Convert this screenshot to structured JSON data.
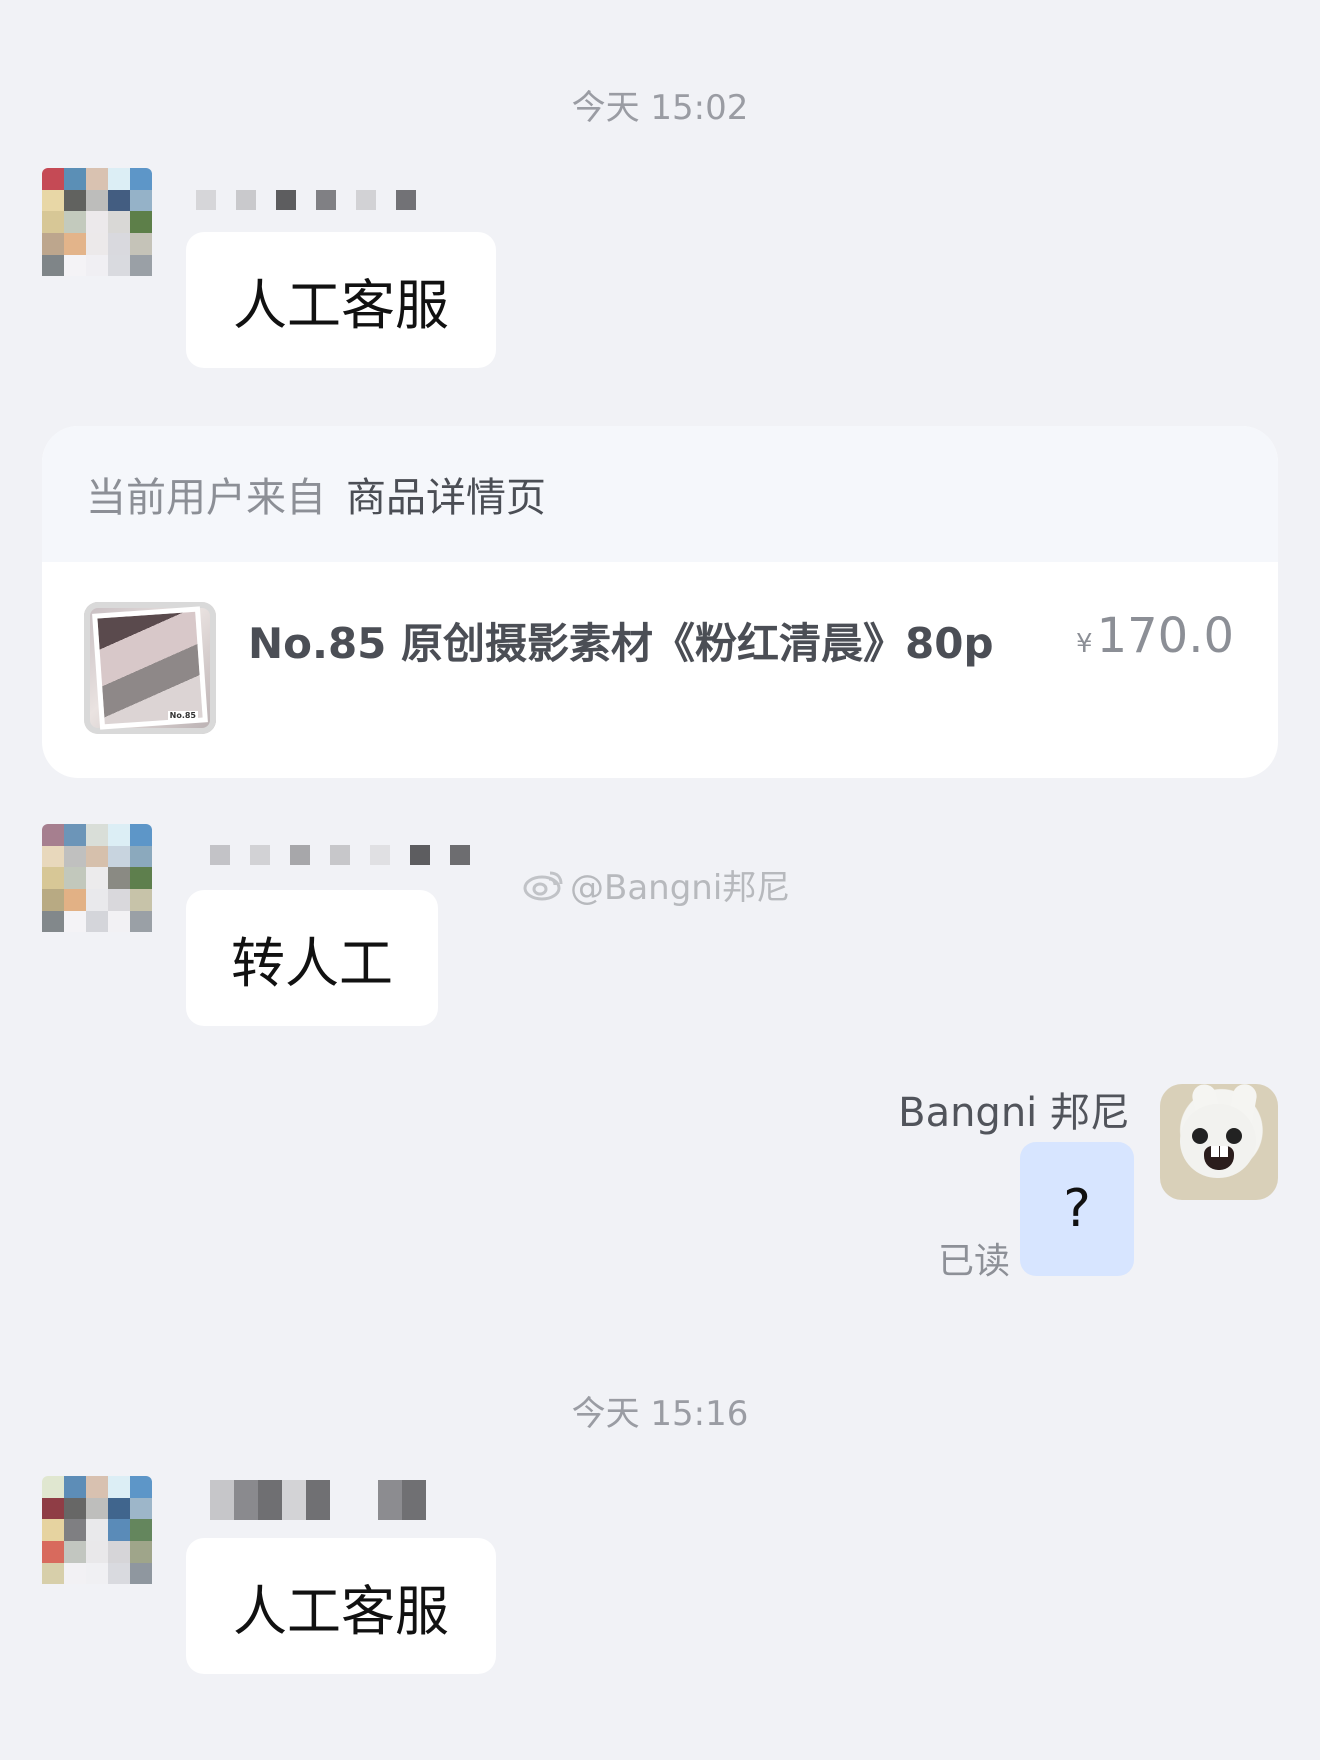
{
  "timestamps": {
    "first": "今天 15:02",
    "second": "今天 15:16"
  },
  "messages": {
    "first_incoming": "人工客服",
    "second_incoming": "转人工",
    "third_incoming": "人工客服",
    "outgoing": "?"
  },
  "source_card": {
    "label": "当前用户来自",
    "page": "商品详情页",
    "product": {
      "title": "No.85 原创摄影素材《粉红清晨》80p",
      "currency": "¥",
      "price": "170.0",
      "thumbnail_tag": "No.85"
    }
  },
  "user": {
    "name": "Bangni 邦尼",
    "status": "已读"
  },
  "watermark": {
    "text": "@Bangni邦尼",
    "icon": "weibo-icon"
  },
  "icons": {
    "avatar": "avatar",
    "weibo": "weibo-icon"
  },
  "colors": {
    "background": "#f1f2f6",
    "incoming_bubble": "#ffffff",
    "outgoing_bubble": "#d7e5ff",
    "muted_text": "#9a9ca3"
  }
}
